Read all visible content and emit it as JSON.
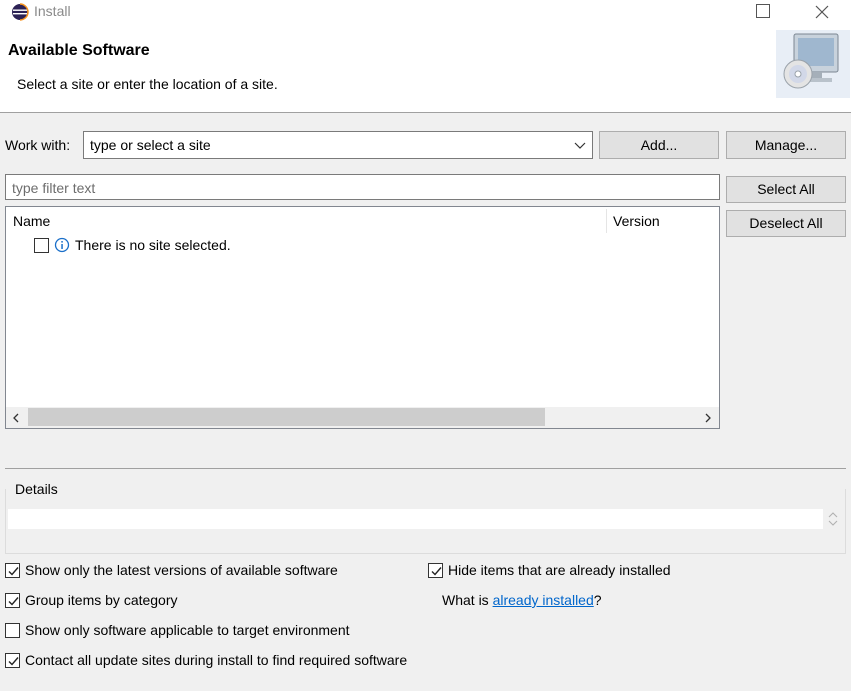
{
  "window": {
    "title": "Install",
    "icons": {
      "app": "eclipse-icon",
      "maximize": "maximize-icon",
      "close": "close-icon"
    }
  },
  "header": {
    "title": "Available Software",
    "description": "Select a site or enter the location of a site.",
    "graphic": "install-software-graphic"
  },
  "work_with": {
    "label": "Work with:",
    "value": "type or select a site",
    "add_label": "Add...",
    "manage_label": "Manage..."
  },
  "filter": {
    "placeholder": "type filter text",
    "select_all_label": "Select All",
    "deselect_all_label": "Deselect All"
  },
  "table": {
    "columns": [
      "Name",
      "Version"
    ],
    "rows": [
      {
        "checked": false,
        "icon": "info-icon",
        "label": "There is no site selected."
      }
    ],
    "scroll_position": 0
  },
  "details": {
    "label": "Details",
    "text": ""
  },
  "options": {
    "latest_versions": {
      "label": "Show only the latest versions of available software",
      "checked": true
    },
    "hide_installed": {
      "label": "Hide items that are already installed",
      "checked": true
    },
    "group_by_category": {
      "label": "Group items by category",
      "checked": true
    },
    "what_is_prefix": "What is ",
    "already_installed_link": "already installed",
    "what_is_suffix": "?",
    "target_environment": {
      "label": "Show only software applicable to target environment",
      "checked": false
    },
    "contact_update_sites": {
      "label": "Contact all update sites during install to find required software",
      "checked": true
    }
  },
  "colors": {
    "link": "#0066cc",
    "background": "#f0f0f0",
    "button": "#e1e1e1"
  }
}
